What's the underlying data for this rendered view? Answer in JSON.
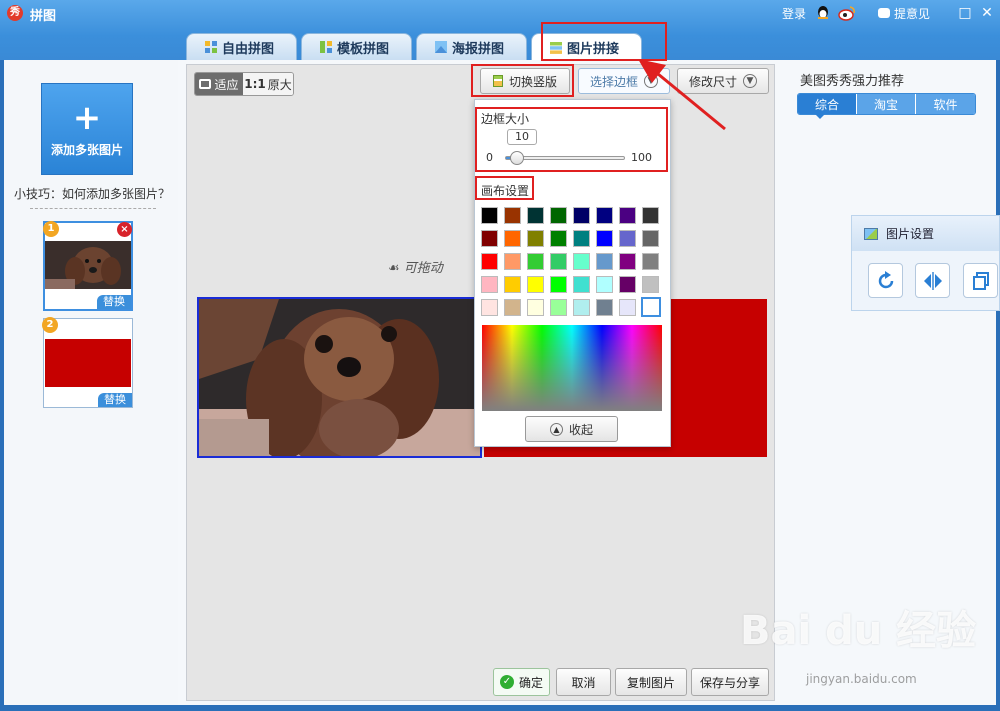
{
  "window": {
    "logo_char": "秀",
    "title": "拼图",
    "login": "登录",
    "feedback": "提意见",
    "maximize": "□",
    "close": "✕"
  },
  "tabs": [
    {
      "label": "自由拼图",
      "icon": "free-collage-icon"
    },
    {
      "label": "模板拼图",
      "icon": "template-collage-icon"
    },
    {
      "label": "海报拼图",
      "icon": "poster-collage-icon"
    },
    {
      "label": "图片拼接",
      "icon": "image-stitch-icon",
      "active": true
    }
  ],
  "left": {
    "add_label": "添加多张图片",
    "tip": "小技巧：如何添加多张图片？",
    "thumbs": [
      {
        "num": "1",
        "replace": "替换"
      },
      {
        "num": "2",
        "replace": "替换"
      }
    ],
    "close_glyph": "×"
  },
  "toolbar": {
    "fit": "适应",
    "orig_bold": "1:1",
    "orig": "原大",
    "switch_vertical": "切换竖版",
    "select_border": "选择边框",
    "resize": "修改尺寸"
  },
  "canvas": {
    "hint": "可拖动"
  },
  "popup": {
    "border_size_title": "边框大小",
    "border_value": "10",
    "slider_min": "0",
    "slider_max": "100",
    "border_fraction": 0.1,
    "canvas_title": "画布设置",
    "collapse": "收起",
    "swatches": [
      [
        "#000000",
        "#993300",
        "#003333",
        "#006600",
        "#000066",
        "#000080",
        "#4b0082",
        "#333333"
      ],
      [
        "#800000",
        "#ff6600",
        "#808000",
        "#008000",
        "#008080",
        "#0000ff",
        "#6666cc",
        "#666666"
      ],
      [
        "#ff0000",
        "#ff9966",
        "#33cc33",
        "#33cc66",
        "#66ffcc",
        "#6699cc",
        "#800080",
        "#808080"
      ],
      [
        "#ffb6c1",
        "#ffcc00",
        "#ffff00",
        "#00ff00",
        "#40e0d0",
        "#b0ffff",
        "#660066",
        "#c0c0c0"
      ],
      [
        "#ffe4e1",
        "#d2b48c",
        "#ffffe0",
        "#99ff99",
        "#b0eeee",
        "#708090",
        "#e6e6fa",
        "#ffffff"
      ]
    ]
  },
  "bottom": {
    "ok": "确定",
    "cancel": "取消",
    "copy": "复制图片",
    "save_share": "保存与分享"
  },
  "right": {
    "title": "美图秀秀强力推荐",
    "tabs": [
      "综合",
      "淘宝",
      "软件"
    ],
    "settings_title": "图片设置",
    "settings_buttons": [
      "rotate-icon",
      "flip-horizontal-icon",
      "copy-layer-icon"
    ]
  },
  "watermark": {
    "text": "Bai du 经验",
    "url": "jingyan.baidu.com"
  },
  "colors": {
    "accent": "#3b8fdb",
    "annotation_red": "#e02020",
    "canvas_red": "#c60000"
  }
}
